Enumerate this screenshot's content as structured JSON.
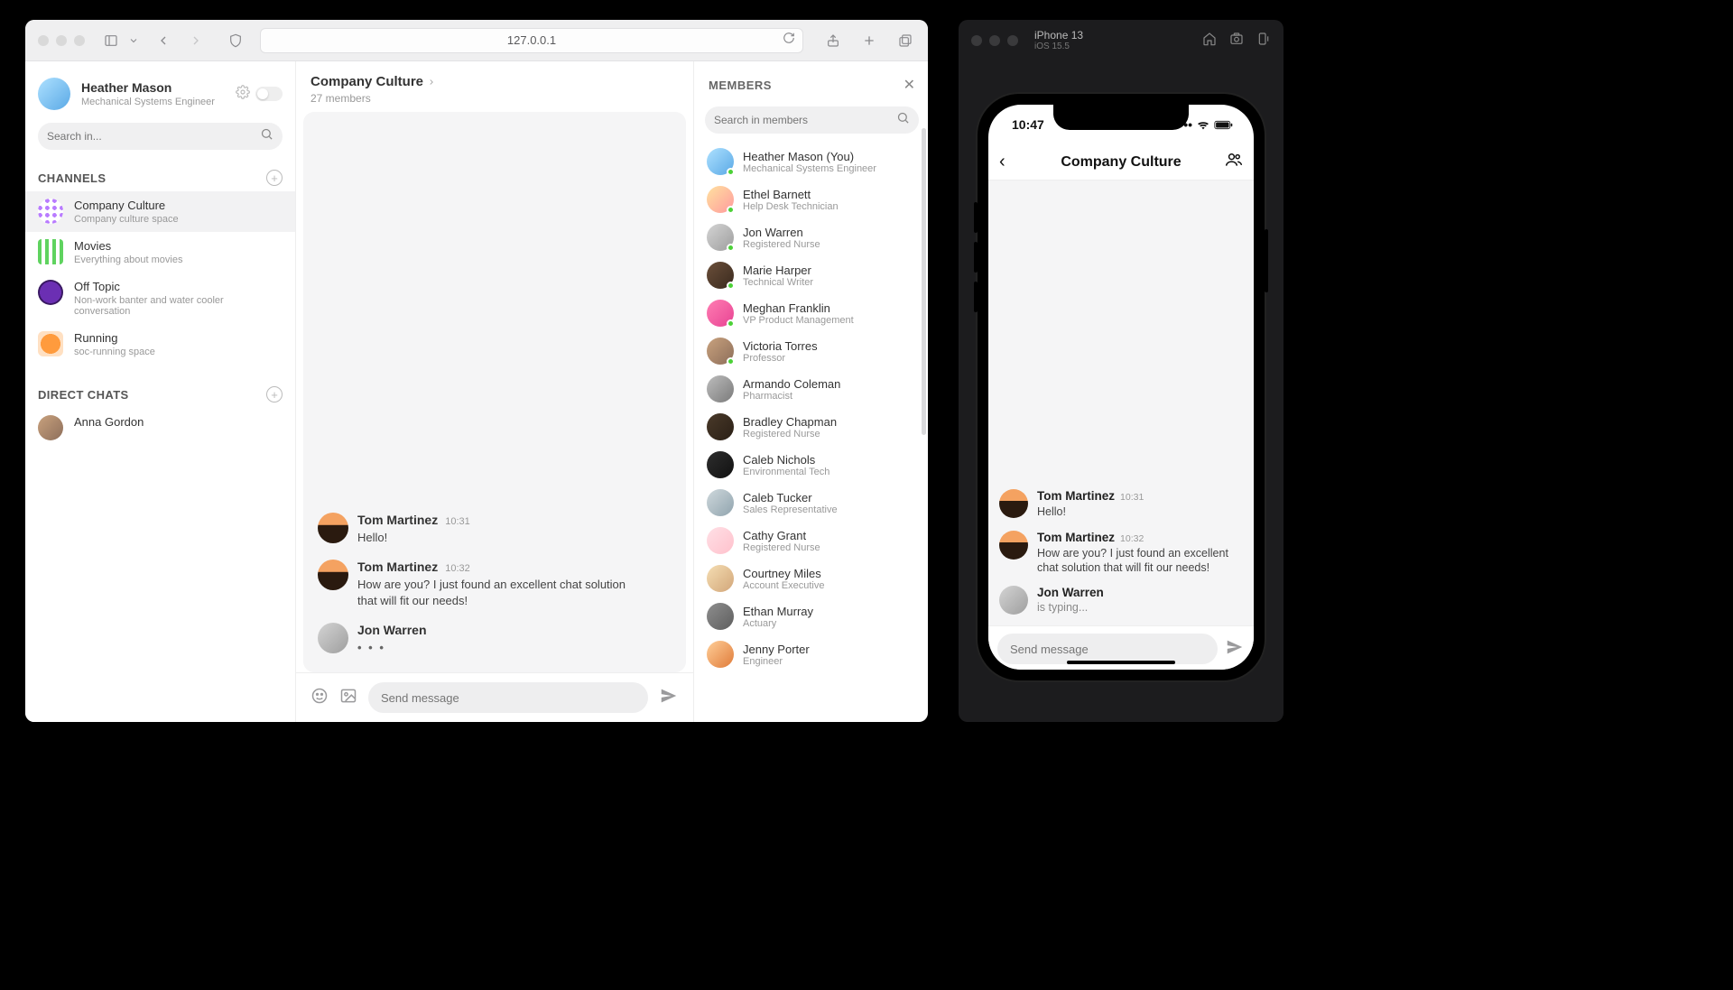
{
  "browser": {
    "url": "127.0.0.1"
  },
  "profile": {
    "name": "Heather Mason",
    "role": "Mechanical Systems Engineer"
  },
  "sidebar": {
    "search_placeholder": "Search in...",
    "channels_title": "CHANNELS",
    "direct_title": "DIRECT CHATS",
    "channels": [
      {
        "name": "Company Culture",
        "desc": "Company culture space"
      },
      {
        "name": "Movies",
        "desc": "Everything about movies"
      },
      {
        "name": "Off Topic",
        "desc": "Non-work banter and water cooler conversation"
      },
      {
        "name": "Running",
        "desc": "soc-running space"
      }
    ],
    "dms": [
      {
        "name": "Anna Gordon"
      }
    ]
  },
  "main": {
    "room_name": "Company Culture",
    "members_count": "27 members",
    "messages": [
      {
        "author": "Tom Martinez",
        "time": "10:31",
        "body": "Hello!"
      },
      {
        "author": "Tom Martinez",
        "time": "10:32",
        "body": "How are you? I just found an excellent chat solution that will fit our needs!"
      },
      {
        "author": "Jon Warren",
        "time": "",
        "body": ""
      }
    ],
    "composer_placeholder": "Send message"
  },
  "members": {
    "title": "MEMBERS",
    "search_placeholder": "Search in members",
    "list": [
      {
        "name": "Heather Mason (You)",
        "role": "Mechanical Systems Engineer",
        "online": true
      },
      {
        "name": "Ethel Barnett",
        "role": "Help Desk Technician",
        "online": true
      },
      {
        "name": "Jon Warren",
        "role": "Registered Nurse",
        "online": true
      },
      {
        "name": "Marie Harper",
        "role": "Technical Writer",
        "online": true
      },
      {
        "name": "Meghan Franklin",
        "role": "VP Product Management",
        "online": true
      },
      {
        "name": "Victoria Torres",
        "role": "Professor",
        "online": true
      },
      {
        "name": "Armando Coleman",
        "role": "Pharmacist",
        "online": false
      },
      {
        "name": "Bradley Chapman",
        "role": "Registered Nurse",
        "online": false
      },
      {
        "name": "Caleb Nichols",
        "role": "Environmental Tech",
        "online": false
      },
      {
        "name": "Caleb Tucker",
        "role": "Sales Representative",
        "online": false
      },
      {
        "name": "Cathy Grant",
        "role": "Registered Nurse",
        "online": false
      },
      {
        "name": "Courtney Miles",
        "role": "Account Executive",
        "online": false
      },
      {
        "name": "Ethan Murray",
        "role": "Actuary",
        "online": false
      },
      {
        "name": "Jenny Porter",
        "role": "Engineer",
        "online": false
      }
    ]
  },
  "simulator": {
    "device": "iPhone 13",
    "os": "iOS 15.5"
  },
  "mobile": {
    "time": "10:47",
    "title": "Company Culture",
    "messages": [
      {
        "author": "Tom Martinez",
        "time": "10:31",
        "body": "Hello!"
      },
      {
        "author": "Tom Martinez",
        "time": "10:32",
        "body": "How are you? I just found an excellent chat solution that will fit our needs!"
      }
    ],
    "typing": {
      "author": "Jon Warren",
      "text": "is typing..."
    },
    "composer_placeholder": "Send message"
  }
}
